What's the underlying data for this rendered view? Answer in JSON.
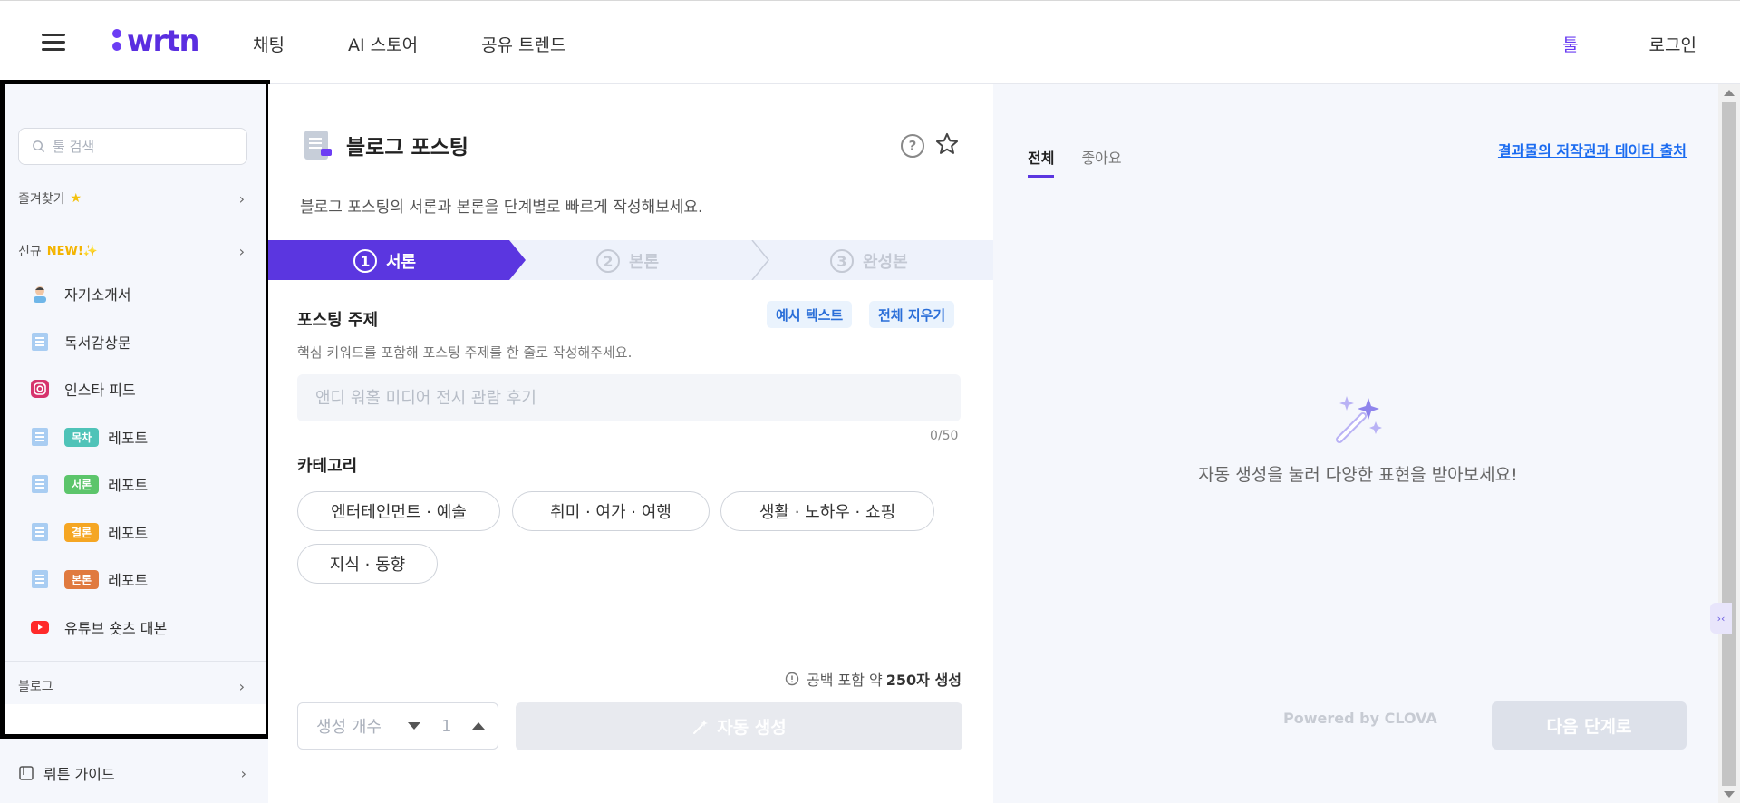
{
  "header": {
    "logo_text": "wrtn",
    "nav": [
      "채팅",
      "AI 스토어",
      "공유 트렌드"
    ],
    "tool_link": "툴",
    "login_link": "로그인"
  },
  "sidebar": {
    "search_placeholder": "툴 검색",
    "favorites": "즐겨찾기",
    "new_section": "신규",
    "new_badge": "NEW!✨",
    "items": [
      {
        "label": "자기소개서",
        "icon": "person-icon"
      },
      {
        "label": "독서감상문",
        "icon": "document-icon"
      },
      {
        "label": "인스타 피드",
        "icon": "instagram-icon"
      },
      {
        "label": "레포트",
        "tag": "목차",
        "tag_color": "#4fc3b8",
        "icon": "document-icon"
      },
      {
        "label": "레포트",
        "tag": "서론",
        "tag_color": "#5cc56b",
        "icon": "document-icon"
      },
      {
        "label": "레포트",
        "tag": "결론",
        "tag_color": "#f5a623",
        "icon": "document-icon"
      },
      {
        "label": "레포트",
        "tag": "본론",
        "tag_color": "#e07a3f",
        "icon": "document-icon"
      },
      {
        "label": "유튜브 숏츠 대본",
        "icon": "youtube-icon"
      }
    ],
    "blog_section": "블로그",
    "guide_label": "뤼튼 가이드"
  },
  "main": {
    "title": "블로그 포스팅",
    "description": "블로그 포스팅의 서론과 본론을 단계별로 빠르게 작성해보세요.",
    "steps": [
      {
        "num": "1",
        "label": "서론"
      },
      {
        "num": "2",
        "label": "본론"
      },
      {
        "num": "3",
        "label": "완성본"
      }
    ],
    "topic_title": "포스팅 주제",
    "example_btn": "예시 텍스트",
    "clear_btn": "전체 지우기",
    "topic_hint": "핵심 키워드를 포함해 포스팅 주제를 한 줄로 작성해주세요.",
    "topic_placeholder": "앤디 워홀 미디어 전시 관람 후기",
    "topic_value": "",
    "counter": "0/50",
    "category_title": "카테고리",
    "categories": [
      "엔터테인먼트 · 예술",
      "취미 · 여가 · 여행",
      "생활 · 노하우 · 쇼핑",
      "지식 · 동향"
    ],
    "gen_note_prefix": "공백 포함 약",
    "gen_note_value": "250자 생성",
    "count_label": "생성 개수",
    "count_value": "1",
    "auto_btn": "자동 생성"
  },
  "right_panel": {
    "tabs": [
      "전체",
      "좋아요"
    ],
    "copyright_link": "결과물의 저작권과 데이터 출처",
    "empty_message": "자동 생성을 눌러 다양한 표현을 받아보세요!",
    "powered_by": "Powered by CLOVA",
    "next_btn": "다음 단계로"
  },
  "colors": {
    "brand": "#5a2ee0",
    "step_active": "#5b36e0",
    "step_inactive_bg": "#eef2fb"
  }
}
